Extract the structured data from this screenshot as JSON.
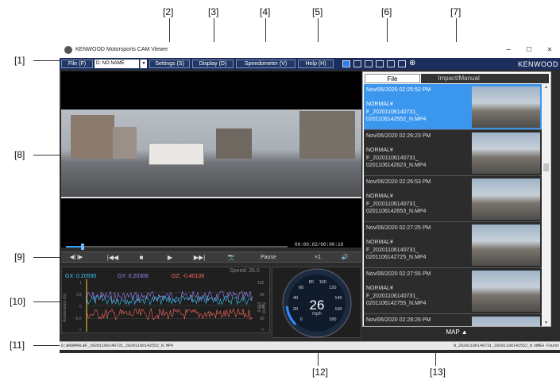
{
  "callouts": [
    "[1]",
    "[2]",
    "[3]",
    "[4]",
    "[5]",
    "[6]",
    "[7]",
    "[8]",
    "[9]",
    "[10]",
    "[11]",
    "[12]",
    "[13]"
  ],
  "window": {
    "title": "KENWOOD Motorsports CAM Viewer",
    "minimize": "–",
    "maximize": "☐",
    "close": "✕"
  },
  "menu": {
    "file": "File (F)",
    "drive_value": "D: NO NAME",
    "drive_arrow": "▼",
    "settings": "Settings (S)",
    "display": "Display (D)",
    "speedometer": "Speedometer (V)",
    "help": "Help (H)",
    "zoom_icon": "⊕",
    "brand": "KENWOOD"
  },
  "player": {
    "timecode": "00:00:02/00:00:10",
    "buttons": {
      "frame": "◀| |▶",
      "prev": "|◀◀",
      "stop": "■",
      "play": "▶",
      "next": "▶▶|",
      "snapshot": "📷",
      "pause": "Pause",
      "speed": "×1",
      "volume": "🔊"
    },
    "progress": 0.07
  },
  "graph": {
    "gx_label": "GX: 0.20595",
    "gy_label": "GY: 0.20306",
    "gz_label": "GZ: -0.40106",
    "speed_label": "Speed: 26.0",
    "left_axis_title": "Acceleration (G)",
    "right_axis_title": "Speed (mph)",
    "left_ticks": [
      "1",
      "0.5",
      "0",
      "-0.5",
      "-1"
    ],
    "right_ticks": [
      "120",
      "90",
      "60",
      "30",
      "0"
    ],
    "colors": {
      "gx": "#39c6f0",
      "gy": "#9a86ff",
      "gz": "#ff6b5a",
      "speed": "#bbbbbb"
    }
  },
  "speedometer": {
    "value": "26",
    "unit": "mph",
    "ticks": [
      "0",
      "20",
      "40",
      "60",
      "80",
      "100",
      "120",
      "140",
      "160",
      "180"
    ],
    "max": 180
  },
  "file_panel": {
    "tab_file": "File",
    "tab_impact": "Impact/Manual",
    "items": [
      {
        "date": "Nov/06/2020 02:25:52 PM",
        "folder": "NORMAL¥",
        "name1": "F_20201106140731_",
        "name2": "0201106142552_N.MP4",
        "selected": true
      },
      {
        "date": "Nov/06/2020 02:26:23 PM",
        "folder": "NORMAL¥",
        "name1": "F_20201106140731_",
        "name2": "0201106142623_N.MP4",
        "selected": false
      },
      {
        "date": "Nov/06/2020 02:26:53 PM",
        "folder": "NORMAL¥",
        "name1": "F_20201106140731_",
        "name2": "0201106142653_N.MP4",
        "selected": false
      },
      {
        "date": "Nov/06/2020 02:27:25 PM",
        "folder": "NORMAL¥",
        "name1": "F_20201106140731_",
        "name2": "0201106142725_N.MP4",
        "selected": false
      },
      {
        "date": "Nov/06/2020 02:27:55 PM",
        "folder": "NORMAL¥",
        "name1": "F_20201106140731_",
        "name2": "0201106142755_N.MP4",
        "selected": false
      },
      {
        "date": "Nov/06/2020 02:28:26 PM",
        "folder": "",
        "name1": "",
        "name2": "",
        "selected": false
      }
    ]
  },
  "map_label": "MAP",
  "map_icon": "▲",
  "status": {
    "left": "D:¥NORMAL¥F_20201106140731_20201106142552_N.MP4",
    "right": "N_20201106140731_20201106142552_N.NMEA Found"
  }
}
